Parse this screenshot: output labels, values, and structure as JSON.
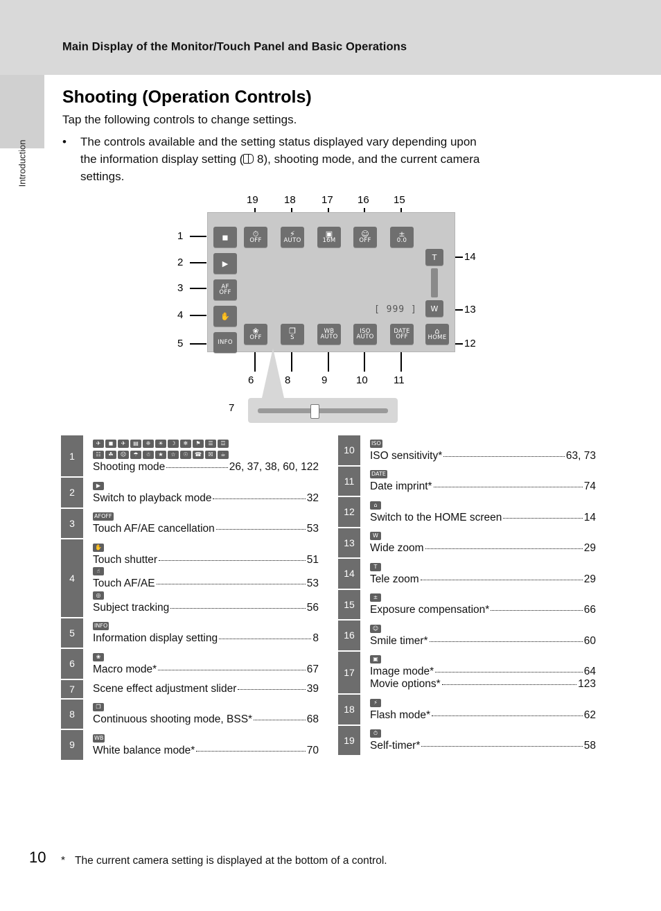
{
  "header": {
    "title": "Main Display of the Monitor/Touch Panel and Basic Operations",
    "side_label": "Introduction"
  },
  "page": {
    "heading": "Shooting (Operation Controls)",
    "lead": "Tap the following controls to change settings.",
    "bullet_dot": "•",
    "bullet_text_1": "The controls available and the setting status displayed vary depending upon",
    "bullet_text_2_pre": "the information display setting (",
    "bullet_text_2_post": " 8), shooting mode, and the current camera",
    "bullet_text_3": "settings.",
    "footnote_star": "*",
    "footnote": "The current camera setting is displayed at the bottom of a control.",
    "page_number": "10"
  },
  "diagram": {
    "callouts_top": [
      "19",
      "18",
      "17",
      "16",
      "15"
    ],
    "callouts_left": [
      "1",
      "2",
      "3",
      "4",
      "5"
    ],
    "callouts_bottom": [
      "6",
      "8",
      "9",
      "10",
      "11"
    ],
    "callouts_right": [
      "14",
      "13",
      "12"
    ],
    "callout_slider": "7",
    "frame_counter": "999",
    "buttons": {
      "shooting_mode": "◼",
      "playback": "▶",
      "touch_af_ae_cancel_l1": "AF",
      "touch_af_ae_cancel_l2": "OFF",
      "touch_shutter": "✋",
      "info": "INFO",
      "self_timer_l1": "⏱",
      "self_timer_l2": "OFF",
      "flash_l1": "⚡",
      "flash_l2": "AUTO",
      "image_mode_l1": "▣",
      "image_mode_l2": "16M",
      "smile_l1": "☺",
      "smile_l2": "OFF",
      "exposure_l1": "±",
      "exposure_l2": "0.0",
      "macro_l1": "❀",
      "macro_l2": "OFF",
      "continuous_l1": "❐",
      "continuous_l2": "S",
      "white_balance_l1": "WB",
      "white_balance_l2": "AUTO",
      "iso_l1": "ISO",
      "iso_l2": "AUTO",
      "date_l1": "DATE",
      "date_l2": "OFF",
      "home_l1": "⌂",
      "home_l2": "HOME",
      "tele": "T",
      "wide": "W"
    }
  },
  "legend_left": [
    {
      "num": "1",
      "icons": [
        "✈",
        "◼",
        "✈",
        "▤",
        "❈",
        "☀",
        "☽",
        "❄",
        "⚑",
        "☰",
        "☲",
        "☷",
        "☘",
        "☹",
        "☂",
        "☃",
        "★",
        "☆",
        "☉",
        "☎",
        "☒",
        "☕"
      ],
      "entries": [
        {
          "label": "Shooting mode",
          "page": "26, 37, 38, 60, 122"
        }
      ]
    },
    {
      "num": "2",
      "icons": [
        "▶"
      ],
      "entries": [
        {
          "label": "Switch to playback mode",
          "page": "32"
        }
      ]
    },
    {
      "num": "3",
      "icons": [
        "AF\nOFF"
      ],
      "entries": [
        {
          "label": "Touch AF/AE cancellation",
          "page": "53"
        }
      ]
    },
    {
      "num": "4",
      "icons": [
        "✋",
        "☝",
        "◎"
      ],
      "entries": [
        {
          "label": "Touch shutter",
          "page": "51"
        },
        {
          "label": "Touch AF/AE",
          "page": "53"
        },
        {
          "label": "Subject tracking",
          "page": "56"
        }
      ]
    },
    {
      "num": "5",
      "icons": [
        "INFO"
      ],
      "entries": [
        {
          "label": "Information display setting",
          "page": "8"
        }
      ]
    },
    {
      "num": "6",
      "icons": [
        "❀"
      ],
      "entries": [
        {
          "label": "Macro mode*",
          "page": "67"
        }
      ]
    },
    {
      "num": "7",
      "icons": [],
      "entries": [
        {
          "label": "Scene effect adjustment slider",
          "page": "39"
        }
      ]
    },
    {
      "num": "8",
      "icons": [
        "❐"
      ],
      "entries": [
        {
          "label": "Continuous shooting mode, BSS*",
          "page": "68"
        }
      ]
    },
    {
      "num": "9",
      "icons": [
        "WB"
      ],
      "entries": [
        {
          "label": "White balance mode*",
          "page": "70"
        }
      ]
    }
  ],
  "legend_right": [
    {
      "num": "10",
      "icons": [
        "ISO"
      ],
      "entries": [
        {
          "label": "ISO sensitivity*",
          "page": "63, 73"
        }
      ]
    },
    {
      "num": "11",
      "icons": [
        "DATE"
      ],
      "entries": [
        {
          "label": "Date imprint*",
          "page": "74"
        }
      ]
    },
    {
      "num": "12",
      "icons": [
        "⌂"
      ],
      "entries": [
        {
          "label": "Switch to the HOME screen",
          "page": "14"
        }
      ]
    },
    {
      "num": "13",
      "icons": [
        "W"
      ],
      "entries": [
        {
          "label": "Wide zoom",
          "page": "29"
        }
      ]
    },
    {
      "num": "14",
      "icons": [
        "T"
      ],
      "entries": [
        {
          "label": "Tele zoom",
          "page": "29"
        }
      ]
    },
    {
      "num": "15",
      "icons": [
        "±"
      ],
      "entries": [
        {
          "label": "Exposure compensation*",
          "page": "66"
        }
      ]
    },
    {
      "num": "16",
      "icons": [
        "☺"
      ],
      "entries": [
        {
          "label": "Smile timer*",
          "page": "60"
        }
      ]
    },
    {
      "num": "17",
      "icons": [
        "▣"
      ],
      "entries": [
        {
          "label": "Image mode*",
          "page": "64"
        },
        {
          "label": "Movie options*",
          "page": "123"
        }
      ]
    },
    {
      "num": "18",
      "icons": [
        "⚡"
      ],
      "entries": [
        {
          "label": "Flash mode*",
          "page": "62"
        }
      ]
    },
    {
      "num": "19",
      "icons": [
        "⏱"
      ],
      "entries": [
        {
          "label": "Self-timer*",
          "page": "58"
        }
      ]
    }
  ]
}
